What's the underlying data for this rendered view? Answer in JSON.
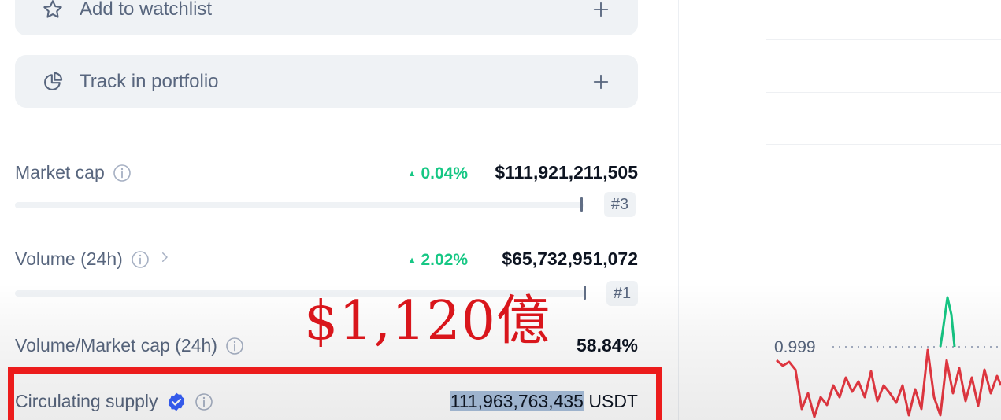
{
  "actions": {
    "watchlist": {
      "label": "Add to watchlist",
      "icon": "star-icon"
    },
    "portfolio": {
      "label": "Track in portfolio",
      "icon": "pie-chart-icon"
    }
  },
  "stats": {
    "market_cap": {
      "label": "Market cap",
      "change": "0.04%",
      "value": "$111,921,211,505",
      "rank": "#3",
      "bar_fraction": 0.94
    },
    "volume": {
      "label": "Volume (24h)",
      "change": "2.02%",
      "value": "$65,732,951,072",
      "rank": "#1",
      "bar_fraction": 0.95
    },
    "vol_mcap": {
      "label": "Volume/Market cap (24h)",
      "value": "58.84%"
    },
    "circulating": {
      "label": "Circulating supply",
      "value_number": "111,963,763,435",
      "value_unit": "USDT"
    }
  },
  "annotation": {
    "text": "$1,120億"
  },
  "chart": {
    "reference_price": "0.999"
  },
  "colors": {
    "positive": "#16c784",
    "negative": "#ea3943",
    "annotation_red": "#ec1c1c",
    "verified_blue": "#3861fb"
  }
}
